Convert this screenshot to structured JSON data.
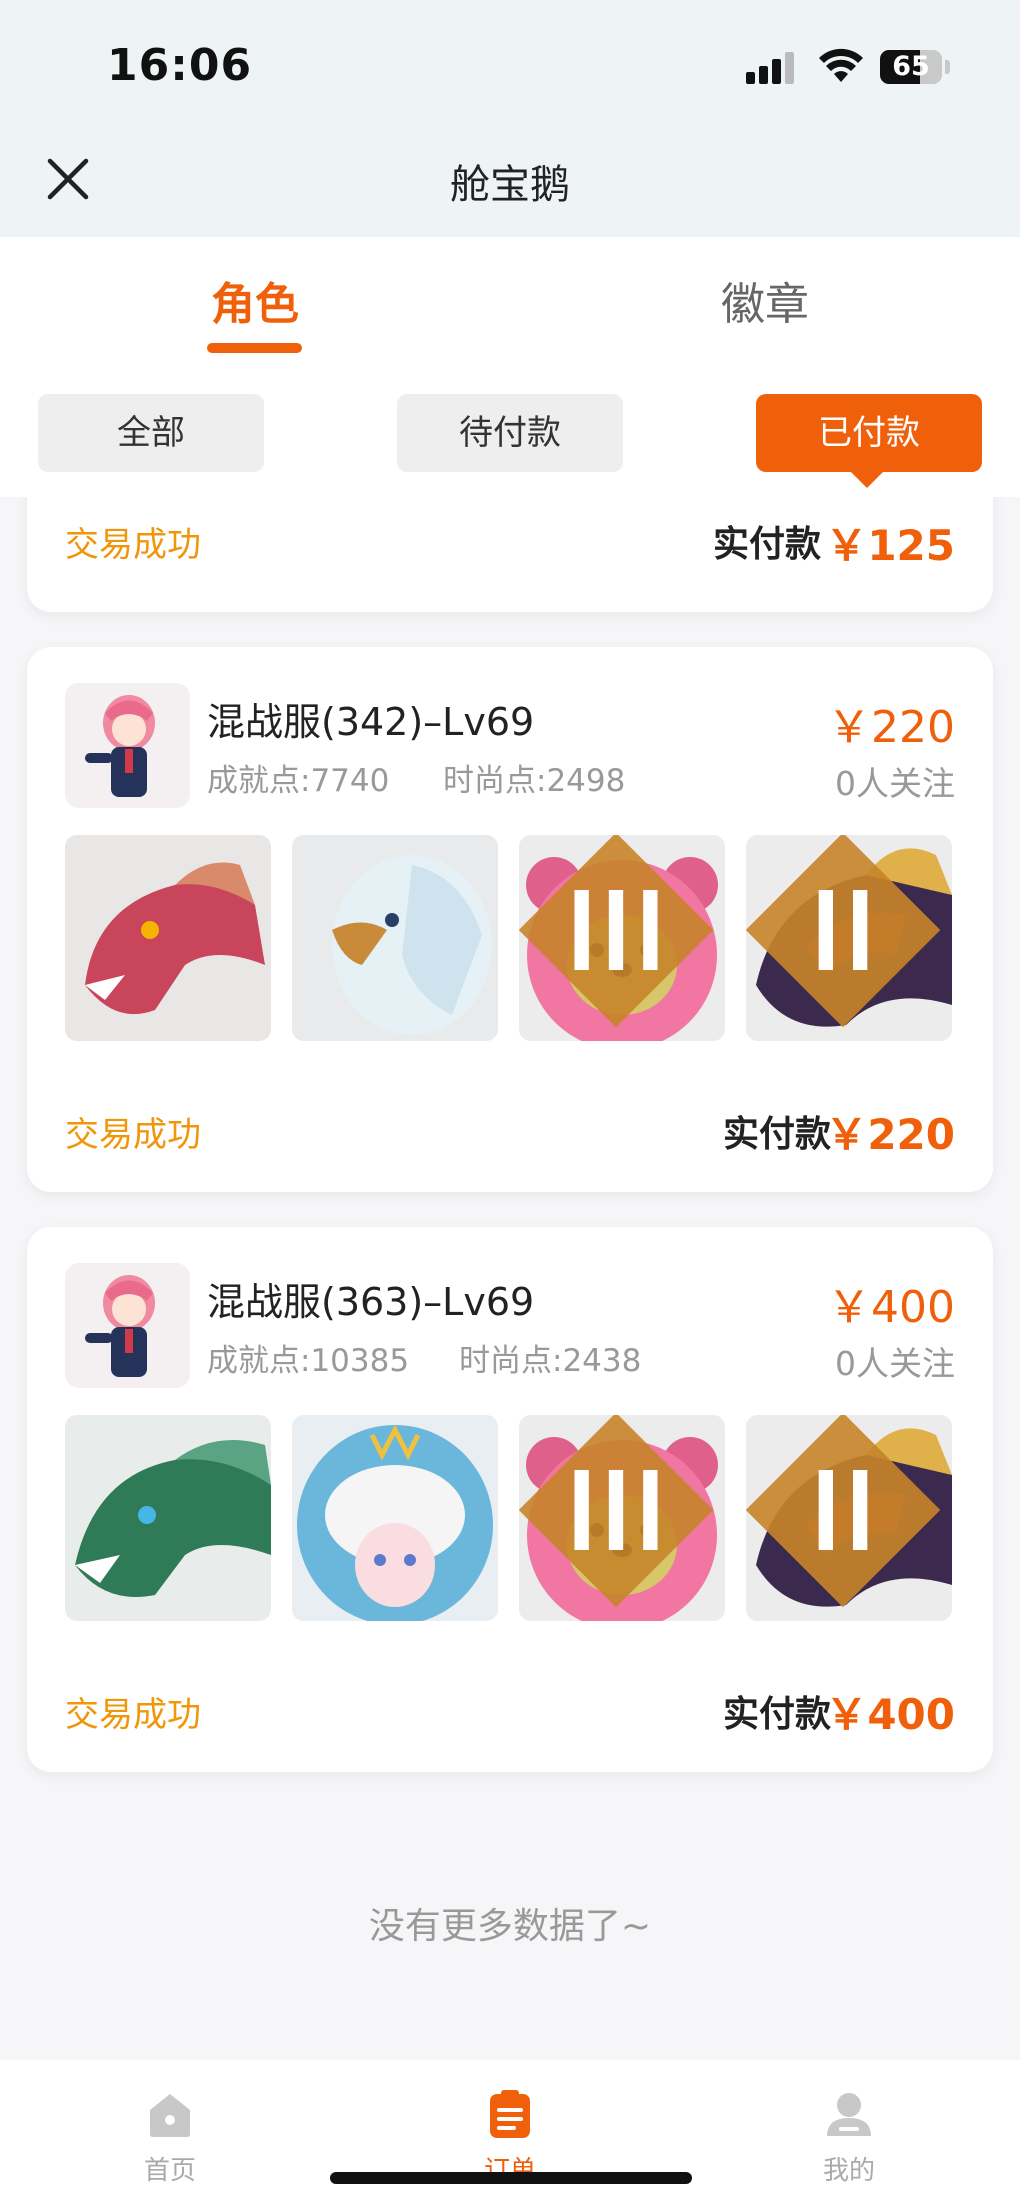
{
  "status_bar": {
    "time": "16:06",
    "battery": "65",
    "battery_level": 0.65
  },
  "header": {
    "title": "舱宝鹅"
  },
  "tabs": [
    {
      "label": "角色"
    },
    {
      "label": "徽章"
    }
  ],
  "filters": [
    {
      "label": "全部"
    },
    {
      "label": "待付款"
    },
    {
      "label": "已付款"
    }
  ],
  "colors": {
    "accent": "#f0600a",
    "status": "#f0960a",
    "muted": "#999999"
  },
  "orders": [
    {
      "status": "交易成功",
      "paid_label": "实付款",
      "paid_value": "￥125"
    },
    {
      "title": "混战服(342)–Lv69",
      "achievement": "成就点:7740",
      "fashion": "时尚点:2498",
      "price": "￥220",
      "followers": "0人关注",
      "items": [
        "red-dragon-mount-icon",
        "white-eagle-mount-icon",
        "pink-bear-pet-icon",
        "dark-dragon-mount-icon"
      ],
      "status": "交易成功",
      "paid_label": "实付款",
      "paid_value": "￥220"
    },
    {
      "title": "混战服(363)–Lv69",
      "achievement": "成就点:10385",
      "fashion": "时尚点:2438",
      "price": "￥400",
      "followers": "0人关注",
      "items": [
        "green-dragon-mount-icon",
        "cloud-girl-pet-icon",
        "pink-bear-pet-icon",
        "dark-dragon-mount-icon"
      ],
      "status": "交易成功",
      "paid_label": "实付款",
      "paid_value": "￥400"
    }
  ],
  "footer": {
    "no_more": "没有更多数据了~"
  },
  "tabbar": [
    {
      "label": "首页",
      "icon": "home-icon"
    },
    {
      "label": "订单",
      "icon": "order-icon"
    },
    {
      "label": "我的",
      "icon": "profile-icon"
    }
  ]
}
